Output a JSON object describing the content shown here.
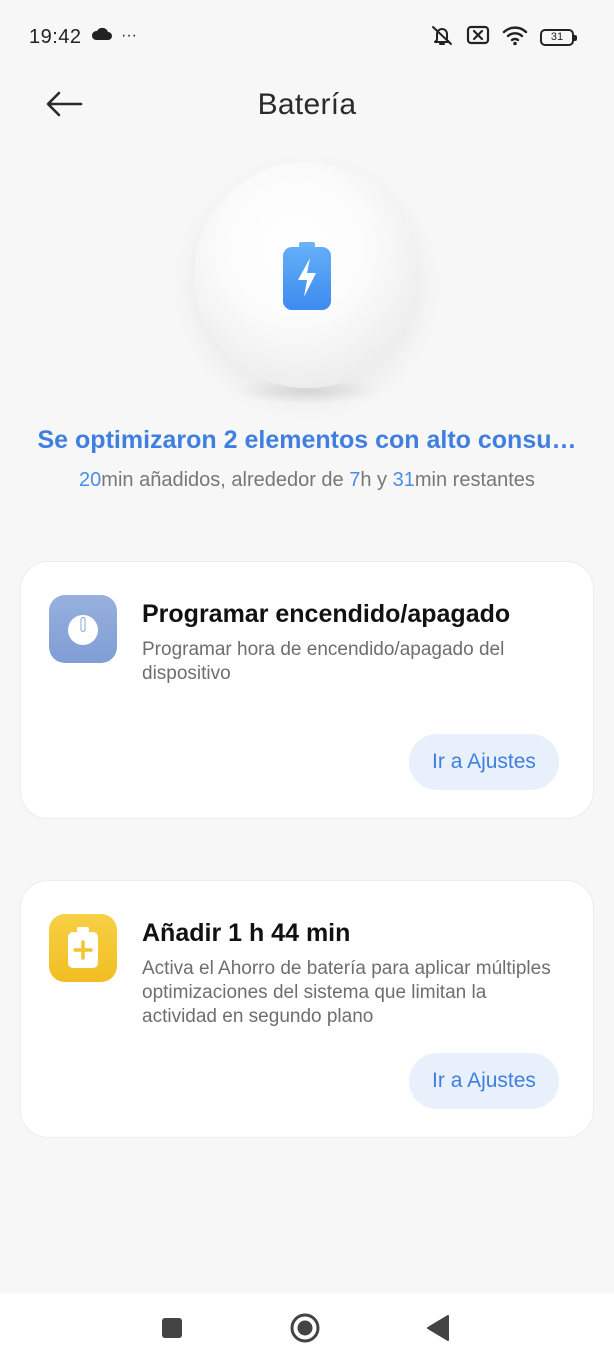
{
  "status_bar": {
    "time": "19:42",
    "more_indicator": "···",
    "battery_level": "31",
    "icons": [
      "cloud-icon",
      "bell-off-icon",
      "sim-off-icon",
      "wifi-icon",
      "battery-icon"
    ]
  },
  "header": {
    "title": "Batería",
    "back_icon": "arrow-left-icon"
  },
  "hero": {
    "title": "Se optimizaron 2 elementos con alto consu…",
    "subtitle": {
      "minutes_added": "20",
      "text_min_added": "min añadidos, alrededor de ",
      "hours": "7",
      "text_h_y": "h y ",
      "minutes_left": "31",
      "text_min_left": "min restantes"
    },
    "icon": "battery-charging-icon"
  },
  "cards": [
    {
      "title": "Programar encendido/apagado",
      "description": "Programar hora de encendido/apagado del dispositivo",
      "button": "Ir a Ajustes",
      "icon": "power-icon",
      "icon_color": "#8aa6d8"
    },
    {
      "title": "Añadir 1 h 44 min",
      "description": "Activa el Ahorro de batería para aplicar múltiples optimizaciones del sistema que limitan la actividad en segundo plano",
      "button": "Ir a Ajustes",
      "icon": "battery-plus-icon",
      "icon_color": "#f4c430"
    }
  ],
  "nav_bar": {
    "icons": [
      "recents-square-icon",
      "home-circle-icon",
      "back-triangle-icon"
    ]
  },
  "colors": {
    "accent": "#3f7fe0",
    "background": "#f7f7f7"
  }
}
